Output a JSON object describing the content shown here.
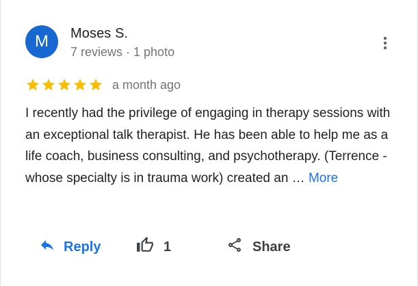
{
  "author": {
    "initial": "M",
    "name": "Moses S.",
    "meta": "7 reviews · 1 photo",
    "avatar_color": "#1967d2"
  },
  "review": {
    "rating": 5,
    "max_rating": 5,
    "date": "a month ago",
    "text": "I recently had the privilege of engaging in therapy sessions with an exceptional talk therapist. He has been able to help me as a life coach, business consulting, and psychotherapy. (Terrence - whose specialty is in trauma work) created an … ",
    "more_label": "More"
  },
  "actions": {
    "reply_label": "Reply",
    "like_count": "1",
    "share_label": "Share"
  },
  "colors": {
    "star": "#fbbc04",
    "link": "#1a73e8",
    "secondary_text": "#70757a"
  },
  "icons": {
    "menu": "more-vert-icon",
    "star": "star-icon",
    "reply": "reply-icon",
    "like": "thumb-up-icon",
    "share": "share-icon"
  }
}
